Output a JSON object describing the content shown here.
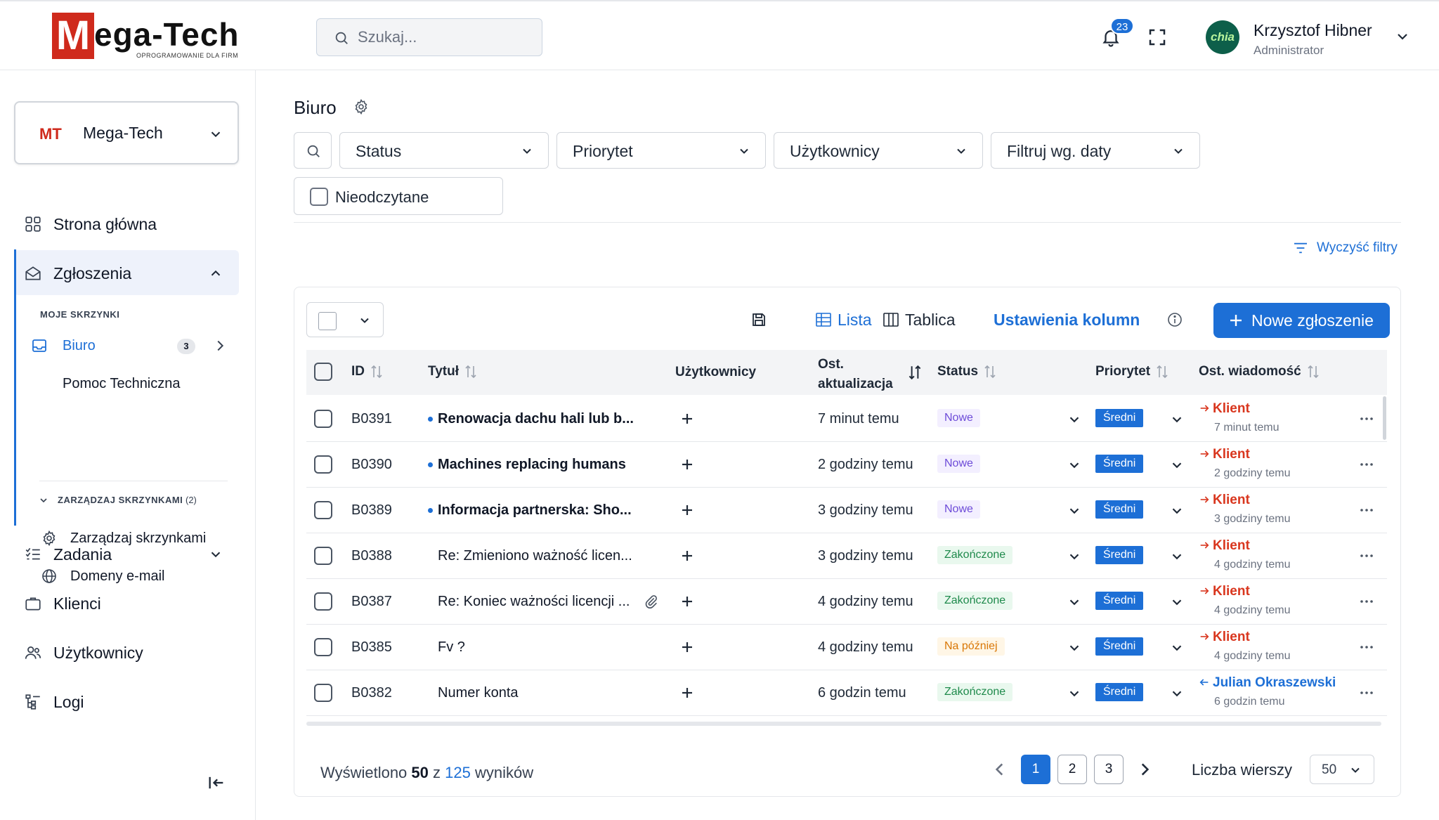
{
  "header": {
    "logo_letter": "M",
    "logo_word": "ega-Tech",
    "logo_tagline": "OPROGRAMOWANIE DLA FIRM",
    "search_placeholder": "Szukaj...",
    "notifications_count": "23",
    "user": {
      "name": "Krzysztof Hibner",
      "role": "Administrator",
      "avatar_text": "chia"
    }
  },
  "sidebar": {
    "org": {
      "abbr": "MT",
      "name": "Mega-Tech"
    },
    "nav": {
      "home": "Strona główna",
      "tickets": "Zgłoszenia",
      "my_boxes_caption": "MOJE SKRZYNKI",
      "boxes": [
        {
          "label": "Biuro",
          "count": "3"
        },
        {
          "label": "Pomoc Techniczna"
        }
      ],
      "manage_caption": "ZARZĄDZAJ SKRZYNKAMI",
      "manage_count": "(2)",
      "manage_items": [
        "Zarządzaj skrzynkami",
        "Domeny e-mail"
      ],
      "tasks": "Zadania",
      "clients": "Klienci",
      "users": "Użytkownicy",
      "logs": "Logi"
    }
  },
  "main": {
    "title": "Biuro",
    "filters": [
      "Status",
      "Priorytet",
      "Użytkownicy",
      "Filtruj wg. daty"
    ],
    "unread_label": "Nieodczytane",
    "clear_filters": "Wyczyść filtry",
    "toolbar": {
      "view_list": "Lista",
      "view_board": "Tablica",
      "column_settings": "Ustawienia kolumn",
      "new_ticket": "Nowe zgłoszenie"
    },
    "columns": {
      "id": "ID",
      "title": "Tytuł",
      "users": "Użytkownicy",
      "updated_line1": "Ost.",
      "updated_line2": "aktualizacja",
      "status": "Status",
      "priority": "Priorytet",
      "last_message": "Ost. wiadomość"
    },
    "rows": [
      {
        "id": "B0391",
        "title": "Renowacja dachu hali lub b...",
        "unread": true,
        "attachment": false,
        "updated": "7 minut temu",
        "status": "Nowe",
        "status_kind": "new",
        "priority": "Średni",
        "msg_from": "Klient",
        "msg_direction": "out",
        "msg_time": "7 minut temu"
      },
      {
        "id": "B0390",
        "title": "Machines replacing humans",
        "unread": true,
        "attachment": false,
        "updated": "2 godziny temu",
        "status": "Nowe",
        "status_kind": "new",
        "priority": "Średni",
        "msg_from": "Klient",
        "msg_direction": "out",
        "msg_time": "2 godziny temu"
      },
      {
        "id": "B0389",
        "title": "Informacja partnerska: Sho...",
        "unread": true,
        "attachment": false,
        "updated": "3 godziny temu",
        "status": "Nowe",
        "status_kind": "new",
        "priority": "Średni",
        "msg_from": "Klient",
        "msg_direction": "out",
        "msg_time": "3 godziny temu"
      },
      {
        "id": "B0388",
        "title": "Re: Zmieniono ważność licen...",
        "unread": false,
        "attachment": false,
        "updated": "3 godziny temu",
        "status": "Zakończone",
        "status_kind": "done",
        "priority": "Średni",
        "msg_from": "Klient",
        "msg_direction": "out",
        "msg_time": "4 godziny temu"
      },
      {
        "id": "B0387",
        "title": "Re: Koniec ważności licencji ...",
        "unread": false,
        "attachment": true,
        "updated": "4 godziny temu",
        "status": "Zakończone",
        "status_kind": "done",
        "priority": "Średni",
        "msg_from": "Klient",
        "msg_direction": "out",
        "msg_time": "4 godziny temu"
      },
      {
        "id": "B0385",
        "title": "Fv ?",
        "unread": false,
        "attachment": false,
        "updated": "4 godziny temu",
        "status": "Na później",
        "status_kind": "later",
        "priority": "Średni",
        "msg_from": "Klient",
        "msg_direction": "out",
        "msg_time": "4 godziny temu"
      },
      {
        "id": "B0382",
        "title": "Numer konta",
        "unread": false,
        "attachment": false,
        "updated": "6 godzin temu",
        "status": "Zakończone",
        "status_kind": "done",
        "priority": "Średni",
        "msg_from": "Julian Okraszewski",
        "msg_direction": "in",
        "msg_time": "6 godzin temu"
      }
    ],
    "footer": {
      "results_prefix": "Wyświetlono",
      "results_shown": "50",
      "results_mid": "z",
      "results_total": "125",
      "results_suffix": "wyników",
      "pages": [
        "1",
        "2",
        "3"
      ],
      "current_page": "1",
      "rows_label": "Liczba wierszy",
      "rows_value": "50"
    }
  },
  "colors": {
    "accent": "#1d6fd6",
    "brand": "#cf2a1c",
    "client_msg": "#d9361e",
    "user_msg": "#1d6fd6"
  }
}
